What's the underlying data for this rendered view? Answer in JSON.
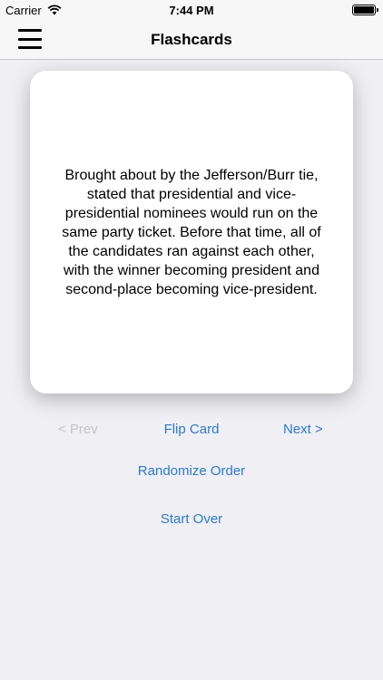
{
  "status_bar": {
    "carrier": "Carrier",
    "time": "7:44 PM",
    "icons": [
      "wifi-icon",
      "battery-icon"
    ]
  },
  "nav": {
    "title": "Flashcards",
    "menu_icon": "hamburger-menu-icon"
  },
  "card": {
    "text": "Brought about by the Jefferson/Burr tie, stated that presidential and vice-presidential nominees would run on the same party ticket. Before that time, all of the candidates ran against each other, with the winner becoming president and second-place becoming vice-president."
  },
  "controls": {
    "prev_label": "< Prev",
    "flip_label": "Flip Card",
    "next_label": "Next >",
    "randomize_label": "Randomize Order",
    "start_over_label": "Start Over"
  },
  "colors": {
    "accent": "#2a7bd1",
    "disabled": "#c4c4c8",
    "background": "#efeff4"
  }
}
